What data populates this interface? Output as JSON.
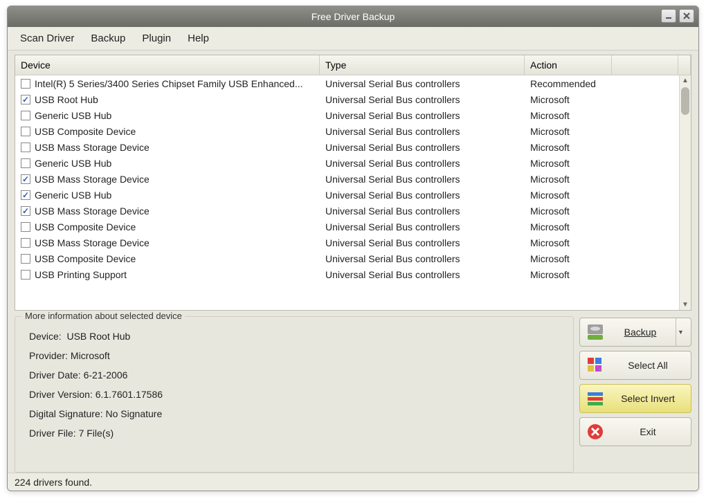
{
  "window": {
    "title": "Free Driver Backup"
  },
  "menu": {
    "items": [
      "Scan Driver",
      "Backup",
      "Plugin",
      "Help"
    ]
  },
  "columns": {
    "device": "Device",
    "type": "Type",
    "action": "Action"
  },
  "rows": [
    {
      "checked": false,
      "device": "Intel(R) 5 Series/3400 Series Chipset Family USB Enhanced...",
      "type": "Universal Serial Bus controllers",
      "action": "Recommended"
    },
    {
      "checked": true,
      "device": "USB Root Hub",
      "type": "Universal Serial Bus controllers",
      "action": "Microsoft"
    },
    {
      "checked": false,
      "device": "Generic USB Hub",
      "type": "Universal Serial Bus controllers",
      "action": "Microsoft"
    },
    {
      "checked": false,
      "device": "USB Composite Device",
      "type": "Universal Serial Bus controllers",
      "action": "Microsoft"
    },
    {
      "checked": false,
      "device": "USB Mass Storage Device",
      "type": "Universal Serial Bus controllers",
      "action": "Microsoft"
    },
    {
      "checked": false,
      "device": "Generic USB Hub",
      "type": "Universal Serial Bus controllers",
      "action": "Microsoft"
    },
    {
      "checked": true,
      "device": "USB Mass Storage Device",
      "type": "Universal Serial Bus controllers",
      "action": "Microsoft"
    },
    {
      "checked": true,
      "device": "Generic USB Hub",
      "type": "Universal Serial Bus controllers",
      "action": "Microsoft"
    },
    {
      "checked": true,
      "device": "USB Mass Storage Device",
      "type": "Universal Serial Bus controllers",
      "action": "Microsoft"
    },
    {
      "checked": false,
      "device": "USB Composite Device",
      "type": "Universal Serial Bus controllers",
      "action": "Microsoft"
    },
    {
      "checked": false,
      "device": "USB Mass Storage Device",
      "type": "Universal Serial Bus controllers",
      "action": "Microsoft"
    },
    {
      "checked": false,
      "device": "USB Composite Device",
      "type": "Universal Serial Bus controllers",
      "action": "Microsoft"
    },
    {
      "checked": false,
      "device": "USB Printing Support",
      "type": "Universal Serial Bus controllers",
      "action": "Microsoft"
    }
  ],
  "info": {
    "legend": "More information about selected device",
    "device_label": "Device:",
    "device_value": "USB Root Hub",
    "provider_label": "Provider:",
    "provider_value": "Microsoft",
    "date_label": "Driver Date:",
    "date_value": "6-21-2006",
    "version_label": "Driver Version:",
    "version_value": "6.1.7601.17586",
    "sig_label": "Digital Signature:",
    "sig_value": "No Signature",
    "file_label": "Driver File:",
    "file_value": "7 File(s)"
  },
  "buttons": {
    "backup": "Backup",
    "select_all": "Select All",
    "select_invert": "Select Invert",
    "exit": "Exit"
  },
  "status": "224 drivers found."
}
